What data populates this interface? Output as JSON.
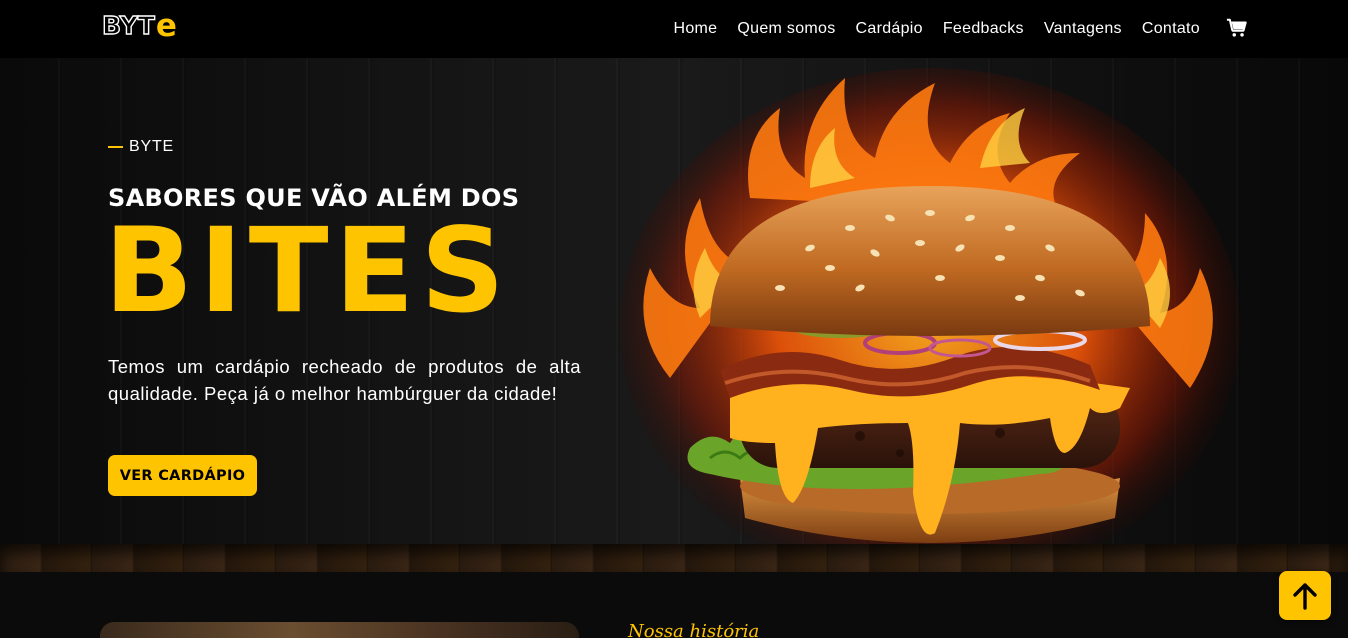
{
  "brand": {
    "logo_main": "BYT",
    "logo_accent": "e"
  },
  "nav": {
    "items": [
      "Home",
      "Quem somos",
      "Cardápio",
      "Feedbacks",
      "Vantagens",
      "Contato"
    ],
    "cart_icon": "cart-icon"
  },
  "hero": {
    "eyebrow": "BYTE",
    "subtitle": "SABORES QUE VÃO ALÉM DOS",
    "title": "BITES",
    "description": "Temos um cardápio recheado de produtos de alta qualidade. Peça já o melhor hambúrguer da cidade!",
    "cta_label": "VER CARDÁPIO",
    "image": "burger-with-flames"
  },
  "about": {
    "label": "Nossa história"
  },
  "scroll_top_icon": "arrow-up-icon",
  "colors": {
    "accent": "#ffc400",
    "background": "#050505",
    "nav": "#000000"
  }
}
